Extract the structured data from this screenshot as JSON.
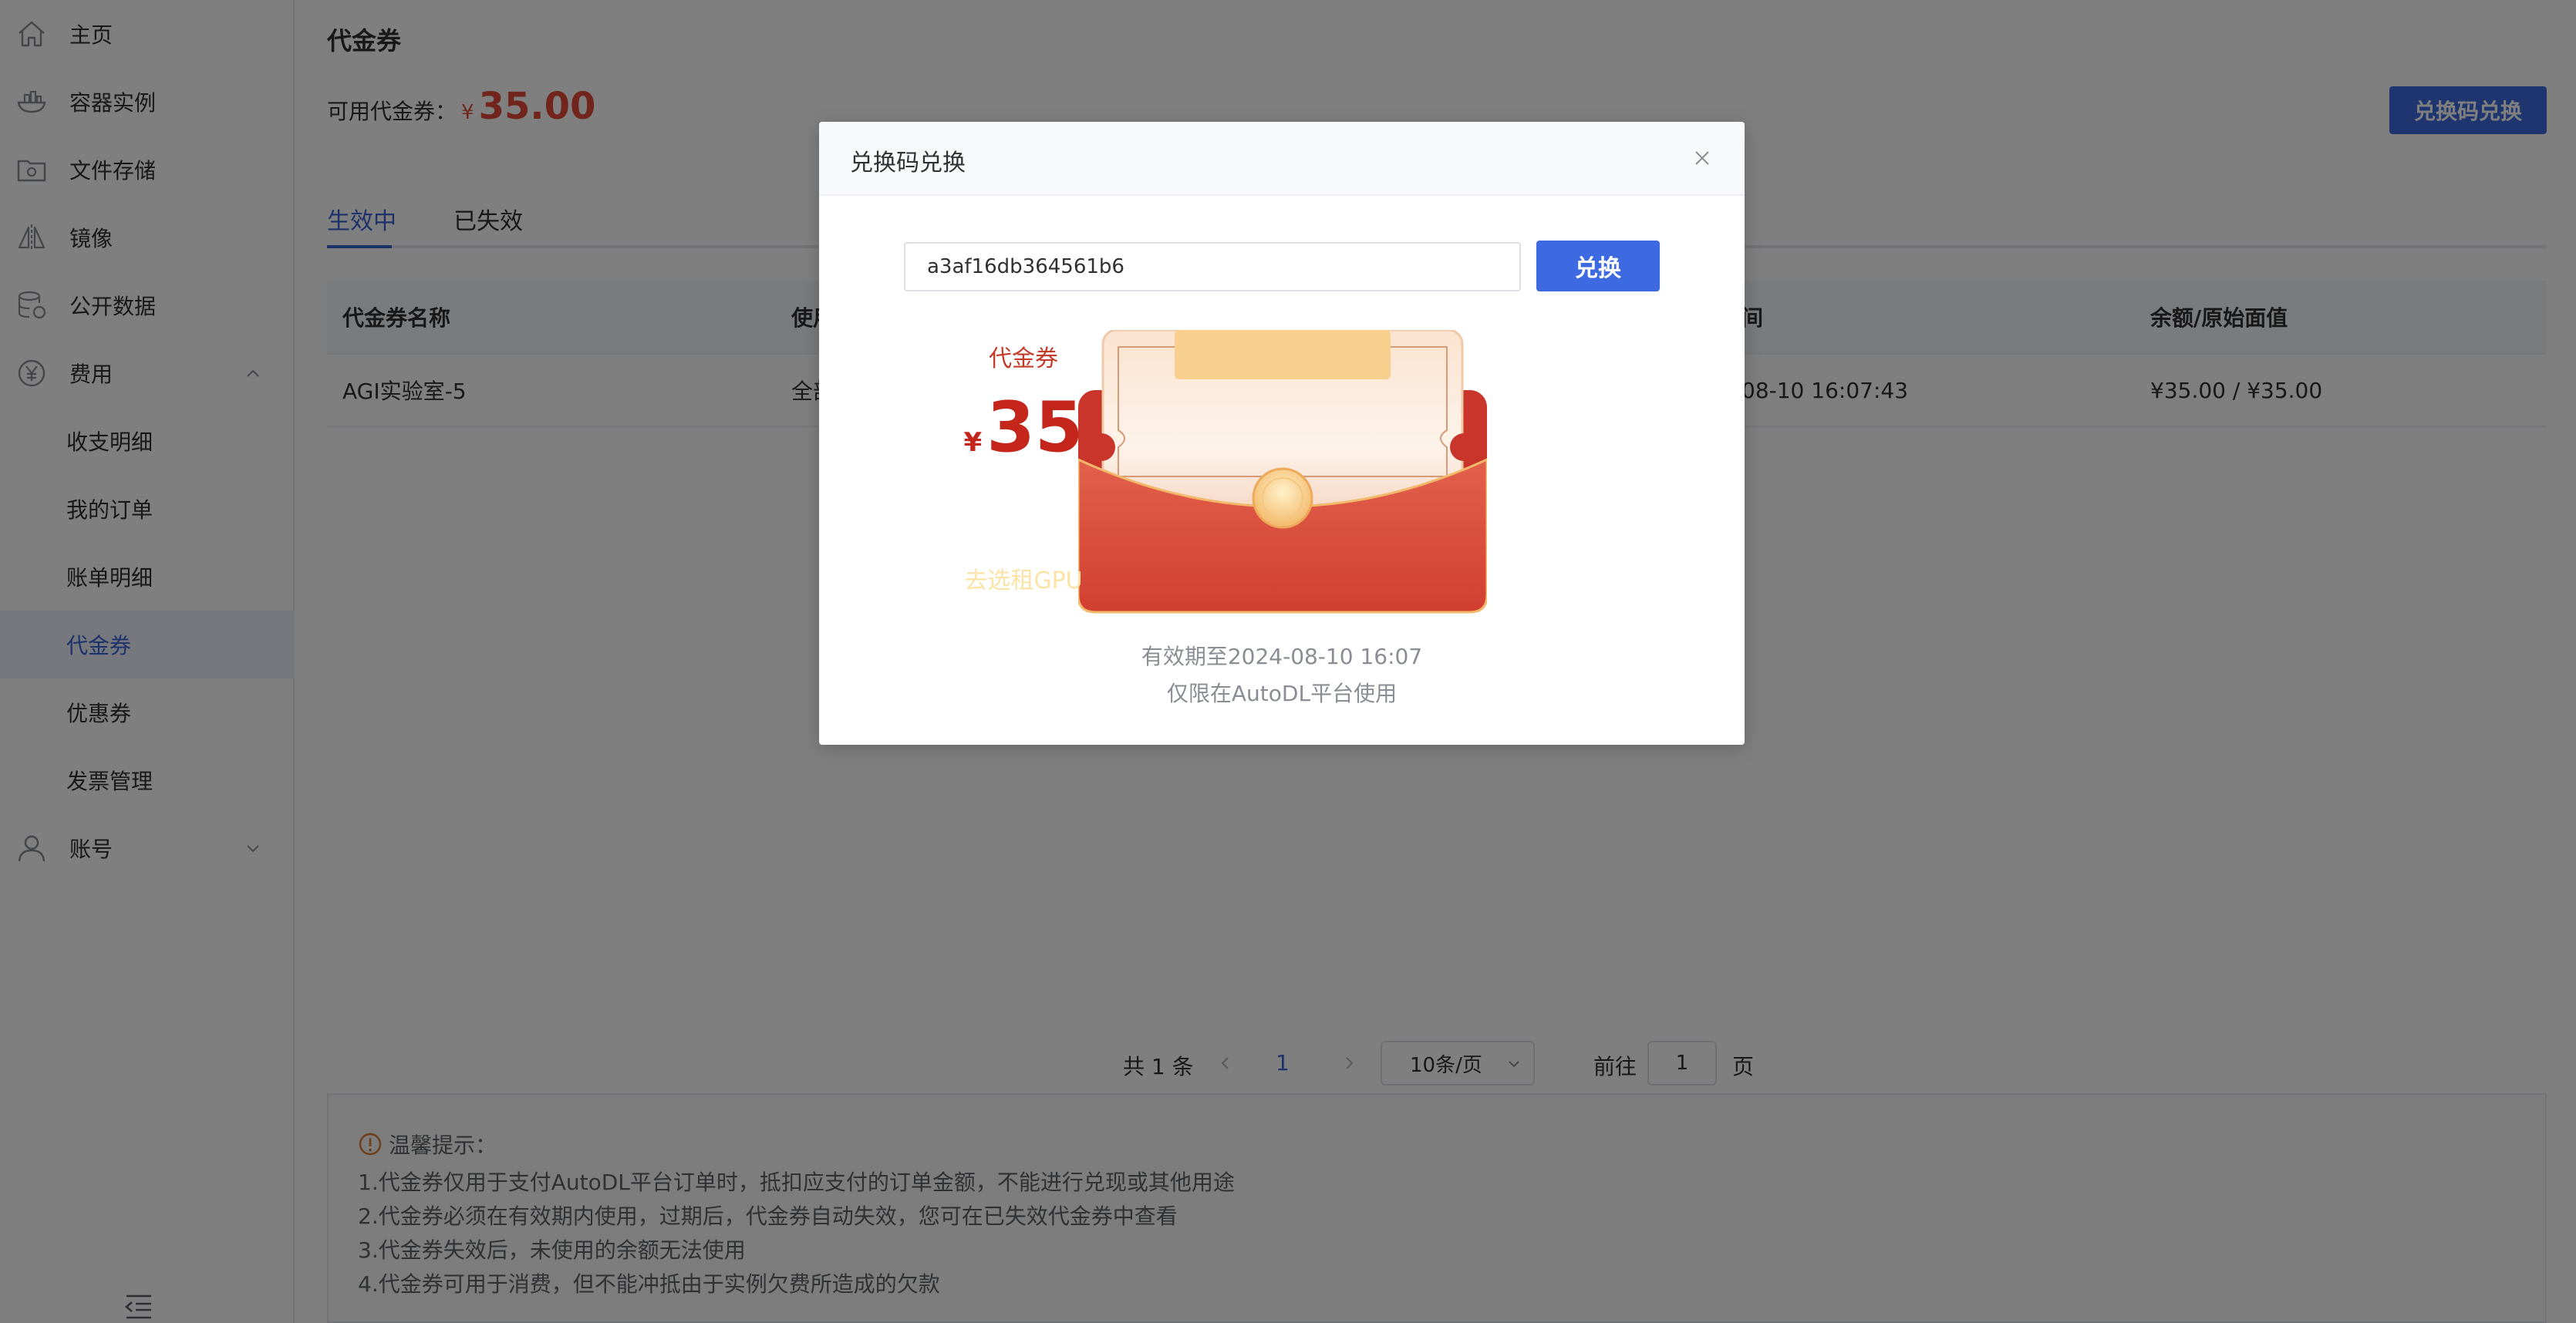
{
  "sidebar": {
    "items": [
      {
        "label": "主页",
        "icon": "home-icon"
      },
      {
        "label": "容器实例",
        "icon": "container-icon"
      },
      {
        "label": "文件存储",
        "icon": "storage-icon"
      },
      {
        "label": "镜像",
        "icon": "mirror-icon"
      },
      {
        "label": "公开数据",
        "icon": "database-icon"
      },
      {
        "label": "费用",
        "icon": "yen-icon",
        "expanded": true
      },
      {
        "label": "账号",
        "icon": "user-icon",
        "expanded": false
      }
    ],
    "sub_items": [
      {
        "label": "收支明细"
      },
      {
        "label": "我的订单"
      },
      {
        "label": "账单明细"
      },
      {
        "label": "代金券",
        "active": true
      },
      {
        "label": "优惠券"
      },
      {
        "label": "发票管理"
      }
    ]
  },
  "page": {
    "title": "代金券",
    "available_label": "可用代金券：",
    "available_currency": "¥",
    "available_amount": "35.00",
    "redeem_button": "兑换码兑换"
  },
  "tabs": [
    {
      "label": "生效中",
      "active": true
    },
    {
      "label": "已失效",
      "active": false
    }
  ],
  "table": {
    "columns": [
      "代金券名称",
      "使用",
      "",
      "间",
      "余额/原始面值"
    ],
    "rows": [
      [
        "AGI实验室-5",
        "全部",
        "",
        "08-10 16:07:43",
        "¥35.00 / ¥35.00"
      ]
    ]
  },
  "pagination": {
    "total_text": "共 1 条",
    "current_page": "1",
    "page_size": "10条/页",
    "goto_label": "前往",
    "goto_value": "1",
    "page_suffix": "页"
  },
  "tips": {
    "title": "温馨提示：",
    "lines": [
      "1.代金券仅用于支付AutoDL平台订单时，抵扣应支付的订单金额，不能进行兑现或其他用途",
      "2.代金券必须在有效期内使用，过期后，代金券自动失效，您可在已失效代金券中查看",
      "3.代金券失效后，未使用的余额无法使用",
      "4.代金券可用于消费，但不能冲抵由于实例欠费所造成的欠款"
    ]
  },
  "dialog": {
    "title": "兑换码兑换",
    "code_value": "a3af16db364561b6",
    "redeem_label": "兑换",
    "voucher": {
      "tag": "代金券",
      "currency": "¥",
      "amount": "35",
      "cta": "去选租GPU"
    },
    "validity": "有效期至2024-08-10 16:07",
    "platform_note": "仅限在AutoDL平台使用"
  },
  "colors": {
    "accent": "#3d6ae0",
    "amount_red": "#e24b3b",
    "envelope_red": "#d9483a",
    "overlay": "rgba(0,0,0,0.5)"
  }
}
